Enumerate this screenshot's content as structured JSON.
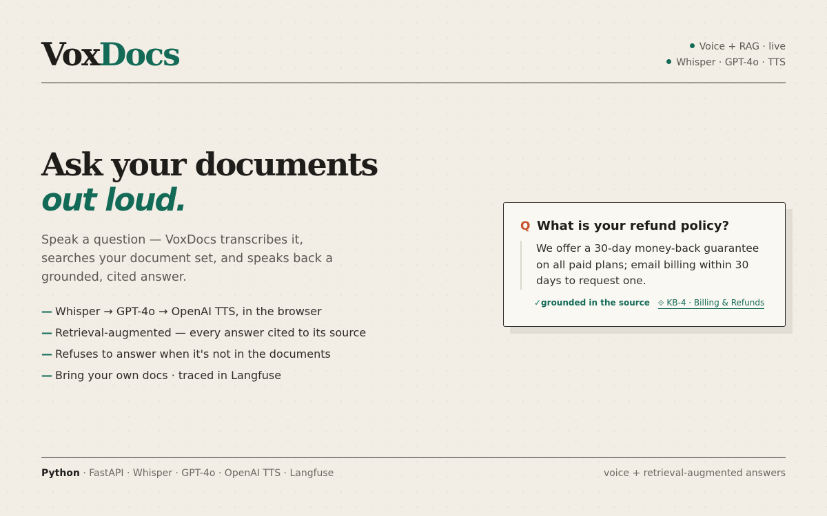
{
  "header": {
    "logo_part1": "Vox",
    "logo_part2": "Docs",
    "status": [
      "Voice + RAG · live",
      "Whisper · GPT-4o · TTS"
    ]
  },
  "hero": {
    "title_line1": "Ask your documents",
    "title_line2": "out loud.",
    "lede": "Speak a question — VoxDocs transcribes it, searches your document set, and speaks back a grounded, cited answer.",
    "features": [
      "Whisper → GPT-4o → OpenAI TTS, in the browser",
      "Retrieval-augmented — every answer cited to its source",
      "Refuses to answer when it's not in the documents",
      "Bring your own docs · traced in Langfuse"
    ],
    "feature_dash": "—"
  },
  "card": {
    "q_mark": "Q",
    "question": "What is your refund policy?",
    "answer": "We offer a 30-day money-back guarantee on all paid plans; email billing within 30 days to request one.",
    "grounded": "✓grounded in the source",
    "source_icon": "⟐",
    "source": "KB-4 · Billing & Refunds"
  },
  "footer": {
    "stack_primary": "Python",
    "stack_rest": " · FastAPI · Whisper · GPT-4o · OpenAI TTS · Langfuse",
    "tagline": "voice + retrieval-augmented answers"
  },
  "colors": {
    "background": "#f2eee6",
    "accent": "#136b57",
    "question_mark": "#c4532c",
    "ink": "#1f1d1a"
  }
}
